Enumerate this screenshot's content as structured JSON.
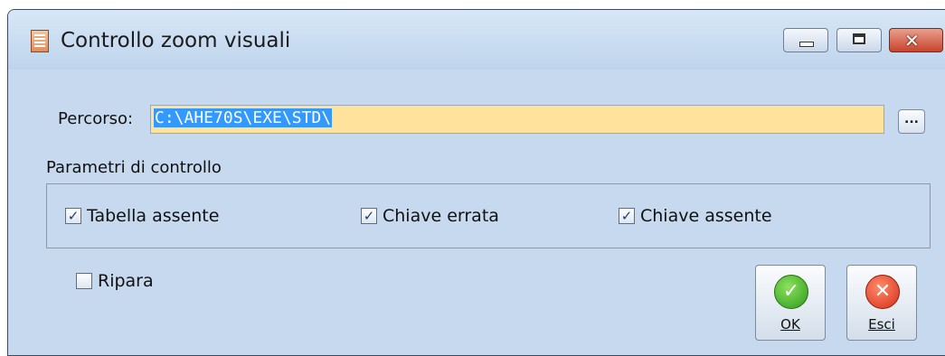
{
  "window": {
    "title": "Controllo zoom visuali",
    "icon": "form-icon",
    "controls": {
      "minimize": "minimize-icon",
      "maximize": "maximize-icon",
      "close": "close-icon",
      "close_glyph": "✕"
    }
  },
  "path": {
    "label": "Percorso:",
    "value": "C:\\AHE70S\\EXE\\STD\\",
    "browse_label": "..."
  },
  "group": {
    "title": "Parametri di controllo",
    "options": [
      {
        "label": "Tabella assente",
        "checked": true
      },
      {
        "label": "Chiave errata",
        "checked": true
      },
      {
        "label": "Chiave assente",
        "checked": true
      }
    ]
  },
  "repair": {
    "label": "Ripara",
    "checked": false
  },
  "buttons": {
    "ok": {
      "label": "OK",
      "icon": "check-icon",
      "glyph": "✓"
    },
    "exit": {
      "label": "Esci",
      "icon": "cross-icon",
      "glyph": "✕"
    }
  },
  "colors": {
    "field_bg": "#ffe29b",
    "selection": "#3399ff",
    "window_bg": "#c6d9ee"
  }
}
